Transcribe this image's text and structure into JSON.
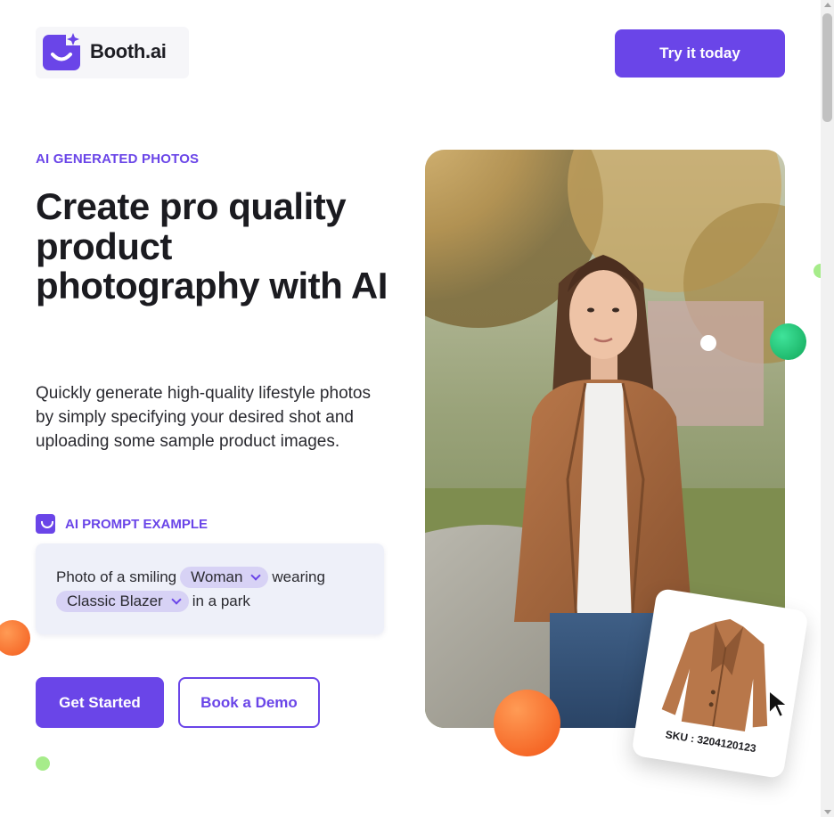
{
  "brand": {
    "name": "Booth.ai",
    "logo_icon": "smile-bag-sparkle-icon",
    "accent": "#6A45E8"
  },
  "header": {
    "cta_label": "Try it today"
  },
  "hero": {
    "eyebrow": "AI GENERATED PHOTOS",
    "headline": "Create pro quality product photography with AI",
    "description": "Quickly generate high-quality lifestyle photos by simply specifying your desired shot and uploading some sample product images.",
    "image_alt": "Woman in a brown blazer standing in a park"
  },
  "prompt": {
    "label": "AI PROMPT EXAMPLE",
    "text_1": "Photo of a smiling",
    "chip_1": "Woman",
    "text_2": "wearing",
    "chip_2": "Classic Blazer",
    "text_3": "in a park"
  },
  "ctas": {
    "primary": "Get Started",
    "secondary": "Book a Demo"
  },
  "product_card": {
    "sku": "SKU : 3204120123",
    "icon": "blazer-product-icon"
  },
  "colors": {
    "orange": "#F35B1C",
    "green": "#12A85A",
    "light_green": "#A6EC8A"
  }
}
